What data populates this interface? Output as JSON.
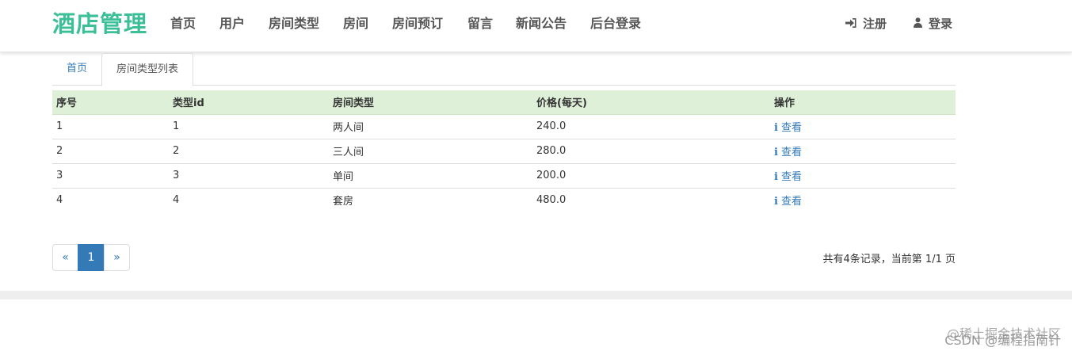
{
  "brand": "酒店管理",
  "nav": {
    "items": [
      "首页",
      "用户",
      "房间类型",
      "房间",
      "房间预订",
      "留言",
      "新闻公告",
      "后台登录"
    ],
    "register": "注册",
    "login": "登录"
  },
  "tabs": {
    "home": "首页",
    "current": "房间类型列表"
  },
  "table": {
    "headers": [
      "序号",
      "类型id",
      "房间类型",
      "价格(每天)",
      "操作"
    ],
    "rows": [
      [
        "1",
        "1",
        "两人间",
        "240.0",
        "查看"
      ],
      [
        "2",
        "2",
        "三人间",
        "280.0",
        "查看"
      ],
      [
        "3",
        "3",
        "单间",
        "200.0",
        "查看"
      ],
      [
        "4",
        "4",
        "套房",
        "480.0",
        "查看"
      ]
    ]
  },
  "pagination": {
    "prev": "«",
    "current": "1",
    "next": "»"
  },
  "page_info": "共有4条记录，当前第 1/1 页",
  "watermark": {
    "line1": "@稀土掘金技术社区",
    "line2": "CSDN @编程指南针"
  },
  "colors": {
    "brand": "#3bbf97",
    "link": "#337ab7",
    "header_bg": "#dff0d8"
  }
}
